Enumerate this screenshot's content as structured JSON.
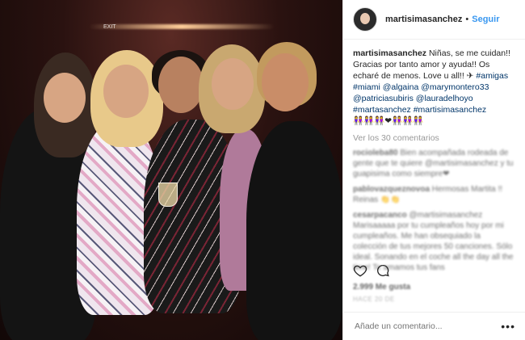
{
  "post": {
    "username": "martisimasanchez",
    "separator": "•",
    "follow_label": "Seguir",
    "caption_text": "Niñas, se me cuidan!! Gracias por tanto amor y ayuda!! Os echaré de menos. Love u all!! ✈",
    "caption_tags": [
      "#amigas",
      "#miami",
      "@algaina",
      "@marymontero33",
      "@patriciasubiris",
      "@lauradelhoyo",
      "#martasanchez",
      "#martisimasanchez"
    ],
    "caption_emoji": "👭👭👭❤👭👭👭",
    "view_all": "Ver los 30 comentarios",
    "comments": [
      {
        "user": "rocioleba80",
        "text": "Bien acompañada rodeada de gente que te quiere @martisimasanchez y tu guapisima como siempre❤"
      },
      {
        "user": "pablovazqueznovoa",
        "text": "Hermosas Martita !! Reinas 👏👏"
      },
      {
        "user": "cesarpacanco",
        "text": "@martisimasanchez Marisaaaaa por tu cumpleaños hoy por mi cumpleaños. Me han obsequiado la colección de tus mejores 50 canciones. Sólo ideal. Sonando en el coche all the day all the time! Te amamos tus fans"
      }
    ],
    "likes": "2.999 Me gusta",
    "date": "HACE 20 DE",
    "add_comment_placeholder": "Añade un comentario...",
    "more_label": "•••",
    "exit_sign": "EXIT"
  },
  "icons": {
    "like": "heart-icon",
    "comment": "comment-icon",
    "more": "more-options-icon"
  },
  "colors": {
    "follow": "#3897f0",
    "link": "#003569",
    "muted": "#999999"
  }
}
